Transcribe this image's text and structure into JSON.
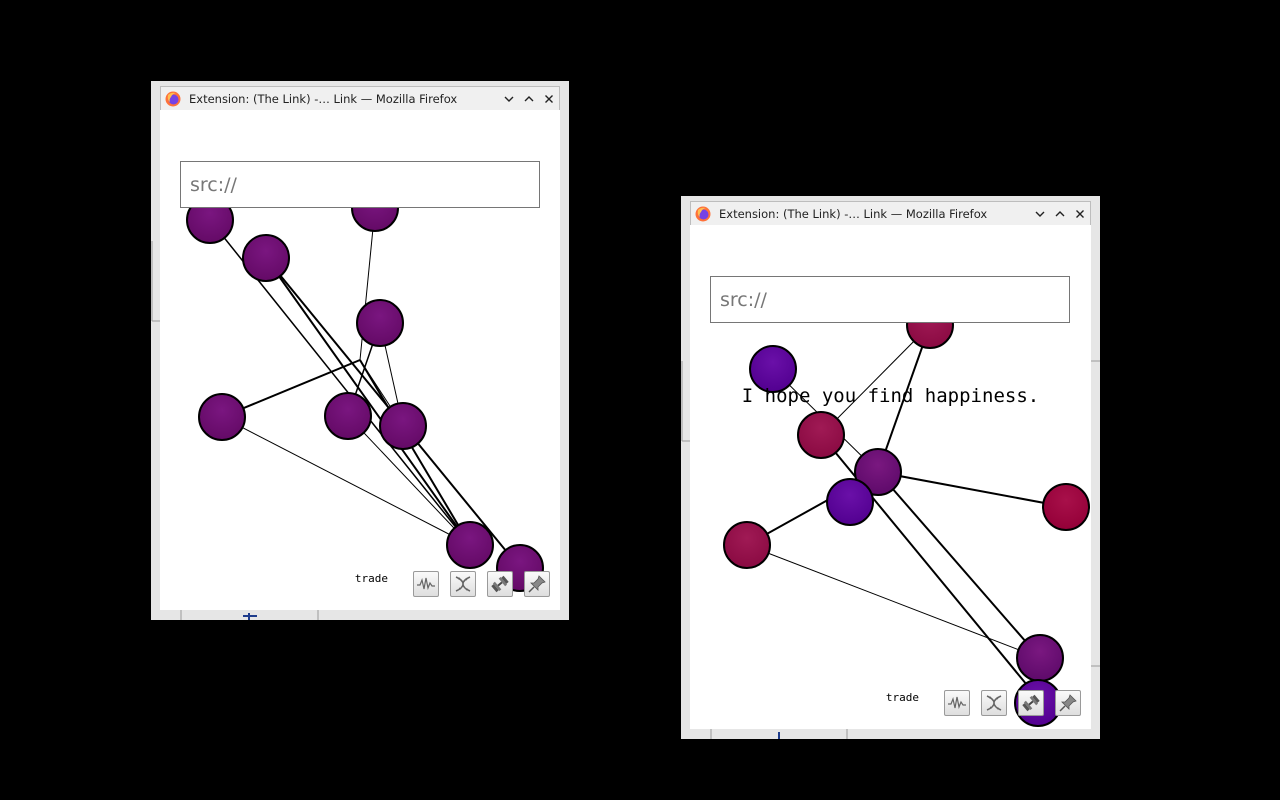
{
  "windows": [
    {
      "title": "Extension: (The Link) -… Link — Mozilla Firefox",
      "input_placeholder": "src://",
      "input_value": "",
      "message": "",
      "toolbar": {
        "label": "trade",
        "buttons": [
          "waveform-icon",
          "dna-icon",
          "dumbbell-icon",
          "pin-icon"
        ]
      },
      "node_color": "#6b0c6b"
    },
    {
      "title": "Extension: (The Link) -… Link — Mozilla Firefox",
      "input_placeholder": "src://",
      "input_value": "",
      "message": "I hope you find happiness.",
      "toolbar": {
        "label": "trade",
        "buttons": [
          "waveform-icon",
          "dna-icon",
          "dumbbell-icon",
          "pin-icon"
        ]
      },
      "node_colors": [
        "#8e0c45",
        "#5a0090",
        "#6a0a70",
        "#9a0040"
      ]
    }
  ]
}
